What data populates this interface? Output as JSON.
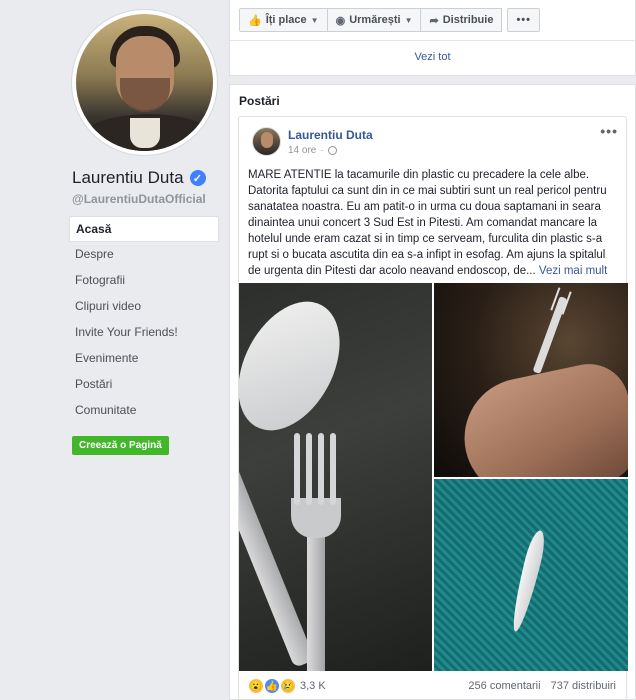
{
  "profile": {
    "name": "Laurentiu Duta",
    "handle": "@LaurentiuDutaOfficial",
    "verified": true
  },
  "nav": {
    "items": [
      {
        "label": "Acasă",
        "active": true
      },
      {
        "label": "Despre"
      },
      {
        "label": "Fotografii"
      },
      {
        "label": "Clipuri video"
      },
      {
        "label": "Invite Your Friends!"
      },
      {
        "label": "Evenimente"
      },
      {
        "label": "Postări"
      },
      {
        "label": "Comunitate"
      }
    ]
  },
  "create_page": {
    "label": "Creează o Pagină"
  },
  "actions": {
    "like": "Îți place",
    "follow": "Urmărești",
    "share": "Distribuie",
    "more": "•••",
    "see_all": "Vezi tot"
  },
  "posts_section": {
    "title": "Postări"
  },
  "post": {
    "author": "Laurentiu Duta",
    "time": "14 ore",
    "menu": "•••",
    "text": "MARE ATENTIE la tacamurile din plastic cu precadere la cele albe. Datorita faptului ca sunt din in ce mai subtiri sunt un real pericol pentru sanatatea noastra. Eu am patit-o in urma cu doua saptamani in seara dinaintea unui concert 3 Sud Est in Pitesti. Am comandat mancare la hotelul unde eram cazat si in timp ce serveam, furculita din plastic s-a rupt si o bucata ascutita din ea s-a infipt in esofag. Am ajuns la spitalul de urgenta din Pitesti dar acolo neavand endoscop, de...",
    "see_more": "Vezi mai mult",
    "reactions_count": "3,3 K",
    "comments": "256 comentarii",
    "shares": "737 distribuiri"
  },
  "colors": {
    "link": "#365899",
    "background": "#e9ebee",
    "create_button": "#42b72a",
    "verified": "#4080ff"
  }
}
